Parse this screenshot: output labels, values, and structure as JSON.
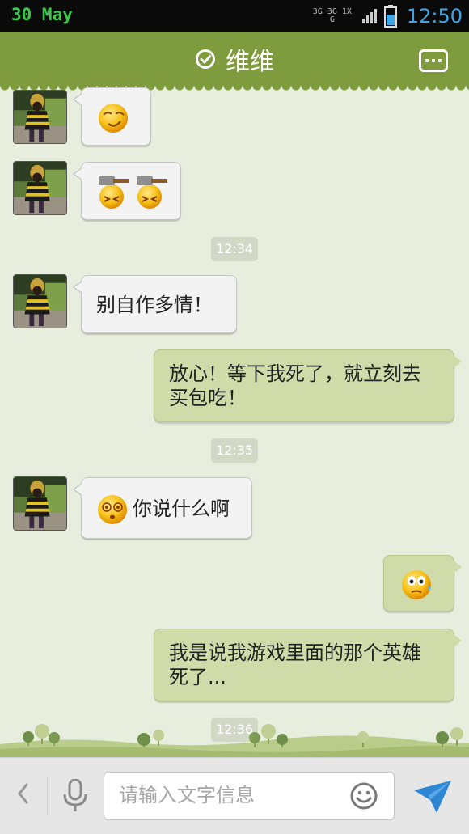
{
  "status_bar": {
    "date": "30 May",
    "network": "3G 3G 1X G",
    "time": "12:50"
  },
  "header": {
    "title": "维维",
    "verified_icon": "check-circle-icon",
    "menu_icon": "more-dots-icon"
  },
  "messages": [
    {
      "side": "in",
      "emoji": "shy-smile-emoji"
    },
    {
      "side": "in",
      "emoji": "hammer-emoji x2"
    },
    {
      "time": "12:34"
    },
    {
      "side": "in",
      "text": "别自作多情！"
    },
    {
      "side": "out",
      "text": "放心！等下我死了，就立刻去买包吃！"
    },
    {
      "time": "12:35"
    },
    {
      "side": "in",
      "emoji": "dizzy-emoji",
      "text": "你说什么啊"
    },
    {
      "side": "out",
      "emoji": "sweat-emoji"
    },
    {
      "side": "out",
      "text": "我是说我游戏里面的那个英雄死了..."
    },
    {
      "time": "12:36"
    }
  ],
  "input_bar": {
    "placeholder": "请输入文字信息",
    "back_icon": "chevron-left-icon",
    "mic_icon": "microphone-icon",
    "emoji_icon": "smiley-icon",
    "send_icon": "send-icon"
  },
  "colors": {
    "header": "#7e9b3d",
    "chat_background": "#e8eedd",
    "outgoing_bubble": "#cfdcaa",
    "incoming_bubble": "#f3f3f3",
    "clock": "#3fa6e6"
  }
}
